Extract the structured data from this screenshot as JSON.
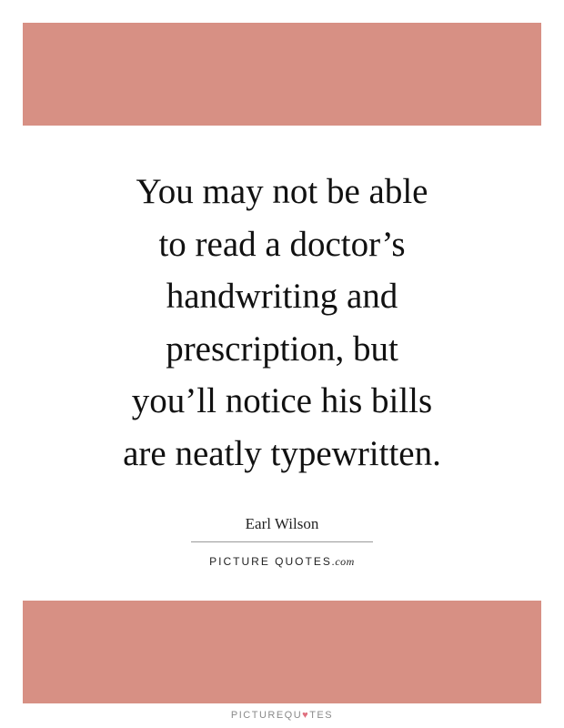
{
  "quote": {
    "lines": [
      "You may not be able",
      "to read a doctor’s",
      "handwriting and",
      "prescription, but",
      "you’ll notice his bills",
      "are neatly typewritten."
    ]
  },
  "attribution": {
    "author": "Earl Wilson",
    "source_main": "PICTURE QUOTES",
    "source_suffix": ".com"
  },
  "footer": {
    "brand_prefix": "PICTUREQU",
    "brand_heart": "♥",
    "brand_suffix": "TES"
  },
  "colors": {
    "banner": "#d79084",
    "text": "#111111",
    "heart": "#e0707f"
  }
}
